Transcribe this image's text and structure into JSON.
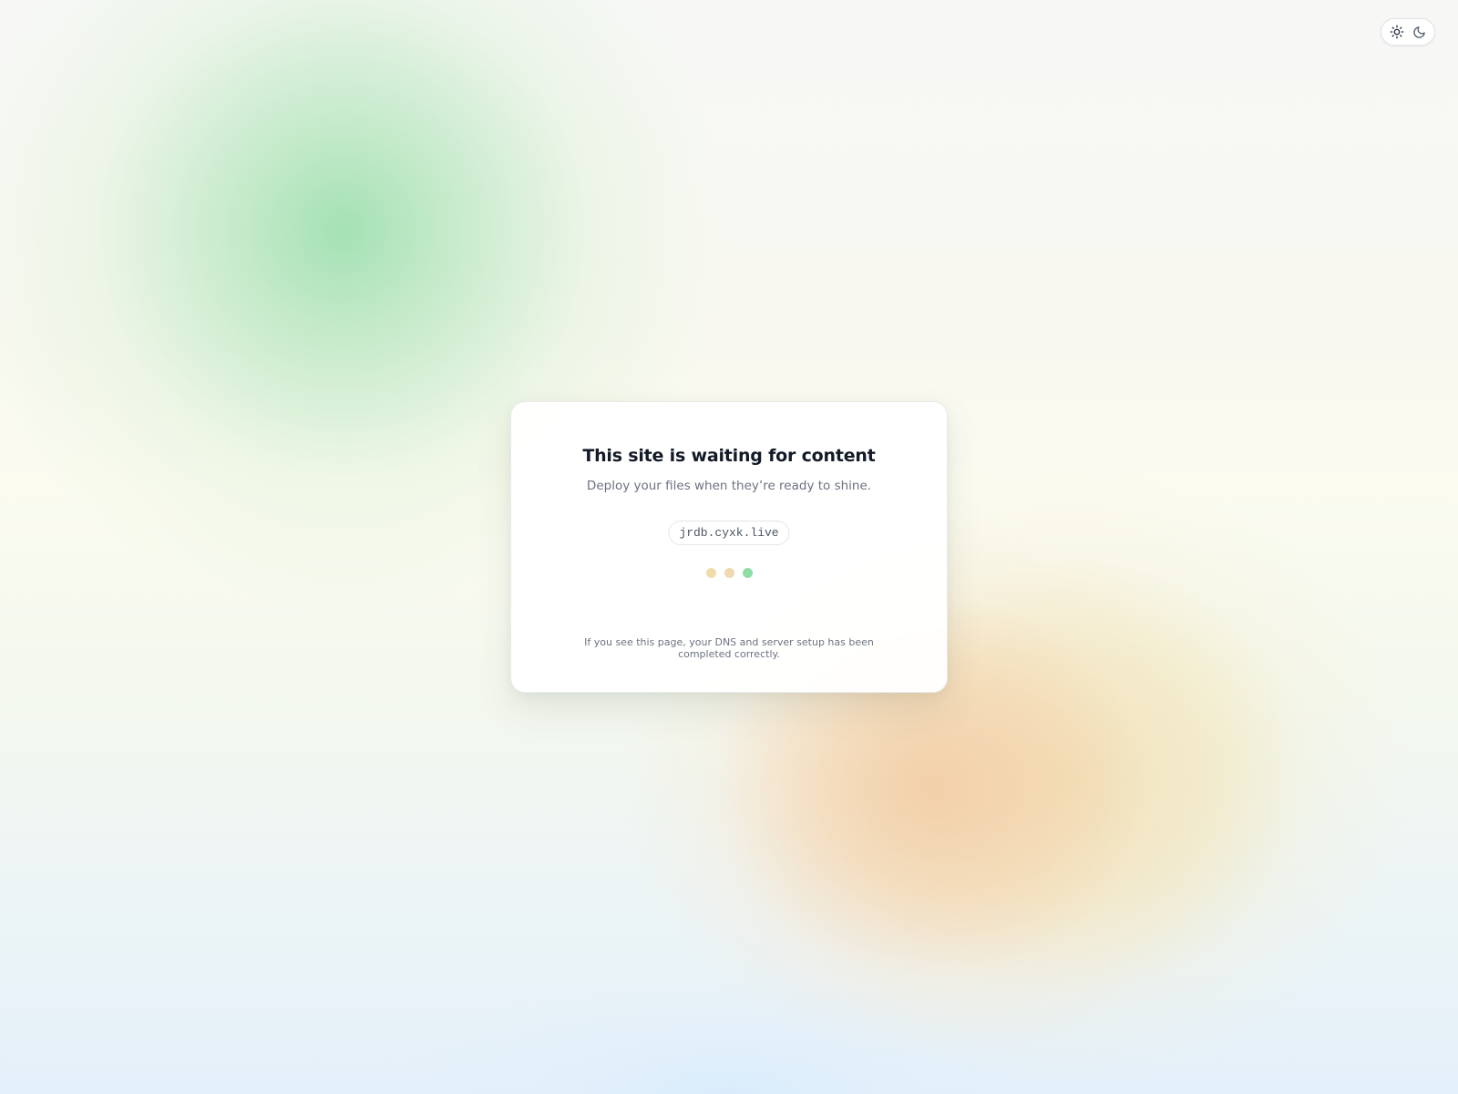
{
  "theme_toggle": {
    "options": [
      {
        "icon": "sun-icon",
        "color": "#1f2937"
      },
      {
        "icon": "moon-icon",
        "color": "#4b5563"
      }
    ]
  },
  "card": {
    "title": "This site is waiting for content",
    "subtitle": "Deploy your files when they’re ready to shine.",
    "domain": "jrdb.cyxk.live",
    "loading_dots": [
      {
        "color": "#f0dca8"
      },
      {
        "color": "#f0d8b0"
      },
      {
        "color": "#8fdca6"
      }
    ],
    "footnote": "If you see this page, your DNS and server setup has been completed correctly."
  },
  "colors": {
    "background_green_glow": "#a0e0b0",
    "background_orange_glow": "#f2cea8",
    "background_yellow_glow": "#eedeaa",
    "background_blue_bottom": "#dff0fc",
    "title_text": "#131a28",
    "muted_text": "#6b7280"
  }
}
